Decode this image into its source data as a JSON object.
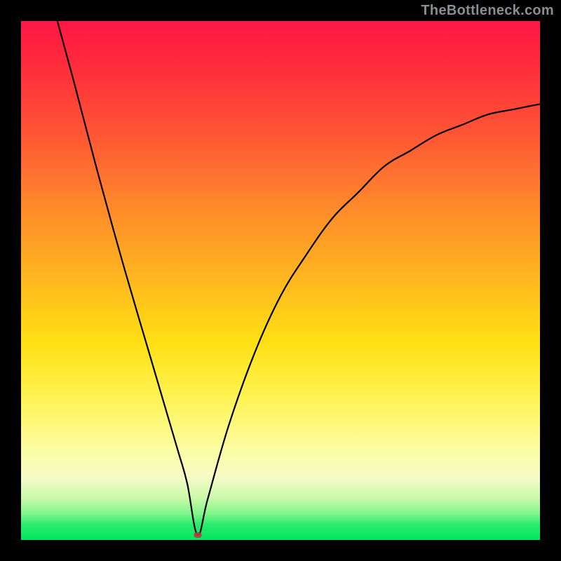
{
  "watermark": "TheBottleneck.com",
  "colors": {
    "frame": "#000000",
    "curve": "#000000",
    "marker": "#b23f3f",
    "gradient_top": "#ff1744",
    "gradient_mid": "#ffe014",
    "gradient_bottom": "#00e95e"
  },
  "chart_data": {
    "type": "line",
    "title": "",
    "xlabel": "",
    "ylabel": "",
    "xlim": [
      0,
      100
    ],
    "ylim": [
      0,
      100
    ],
    "grid": false,
    "legend": false,
    "annotations": [],
    "marker": {
      "x": 34,
      "y": 1
    },
    "series": [
      {
        "name": "curve",
        "x": [
          7,
          10,
          15,
          20,
          25,
          30,
          32,
          34,
          36,
          40,
          45,
          50,
          55,
          60,
          65,
          70,
          75,
          80,
          85,
          90,
          95,
          100
        ],
        "values": [
          100,
          89,
          70,
          52,
          35,
          18,
          11,
          1,
          8,
          22,
          36,
          47,
          55,
          62,
          67,
          72,
          75,
          78,
          80,
          82,
          83,
          84
        ]
      }
    ]
  }
}
